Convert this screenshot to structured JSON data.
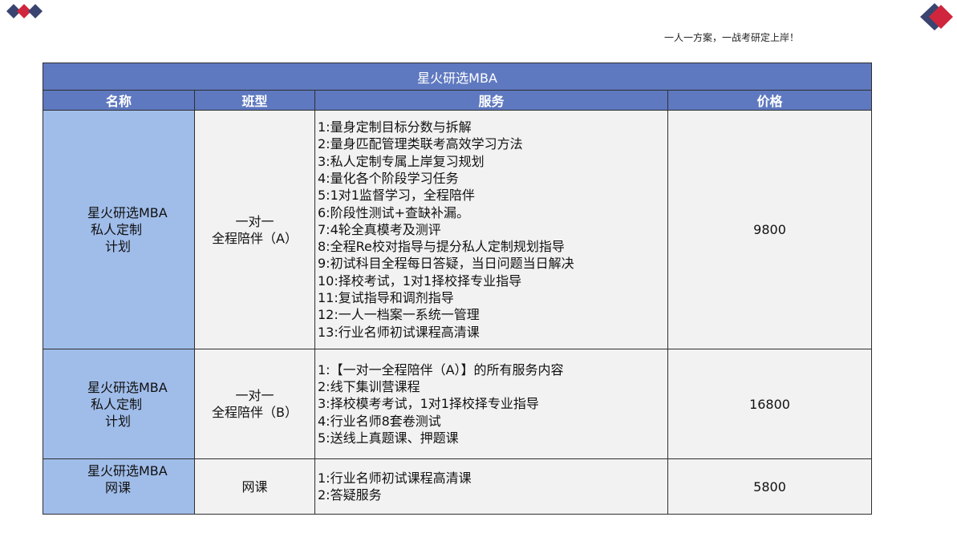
{
  "slogan": "一人一方案，一战考研定上岸！",
  "table": {
    "title": "星火研选MBA",
    "headers": [
      "名称",
      "班型",
      "服务",
      "价格"
    ],
    "rows": [
      {
        "name_lines": [
          "星火研选MBA",
          "私人定制",
          "计划"
        ],
        "class_lines": [
          "一对一",
          "全程陪伴（A）"
        ],
        "services": [
          "1:量身定制目标分数与拆解",
          "2:量身匹配管理类联考高效学习方法",
          "3:私人定制专属上岸复习规划",
          "4:量化各个阶段学习任务",
          "5:1对1监督学习，全程陪伴",
          "6:阶段性测试+查缺补漏。",
          "7:4轮全真模考及测评",
          "8:全程Re校对指导与提分私人定制规划指导",
          "9:初试科目全程每日答疑，当日问题当日解决",
          "10:择校考试，1对1择校择专业指导",
          "11:复试指导和调剂指导",
          "12:一人一档案一系统一管理",
          "13:行业名师初试课程高清课"
        ],
        "price": "9800"
      },
      {
        "name_lines": [
          "星火研选MBA",
          "私人定制",
          "计划"
        ],
        "class_lines": [
          "一对一",
          "全程陪伴（B）"
        ],
        "services": [
          "1:【一对一全程陪伴（A）】的所有服务内容",
          "2:线下集训营课程",
          "3:择校模考考试，1对1择校择专业指导",
          "4:行业名师8套卷测试",
          "5:送线上真题课、押题课"
        ],
        "price": "16800"
      },
      {
        "name_lines": [
          "星火研选MBA",
          "网课"
        ],
        "class_lines": [
          "网课"
        ],
        "services": [
          "1:行业名师初试课程高清课",
          "2:答疑服务"
        ],
        "price": "5800"
      }
    ]
  },
  "colors": {
    "header_blue": "#5f79c0",
    "name_col_blue": "#a0bdea",
    "cell_gray": "#f2f2f2",
    "logo_red": "#d0263d",
    "logo_navy": "#3a4470"
  }
}
